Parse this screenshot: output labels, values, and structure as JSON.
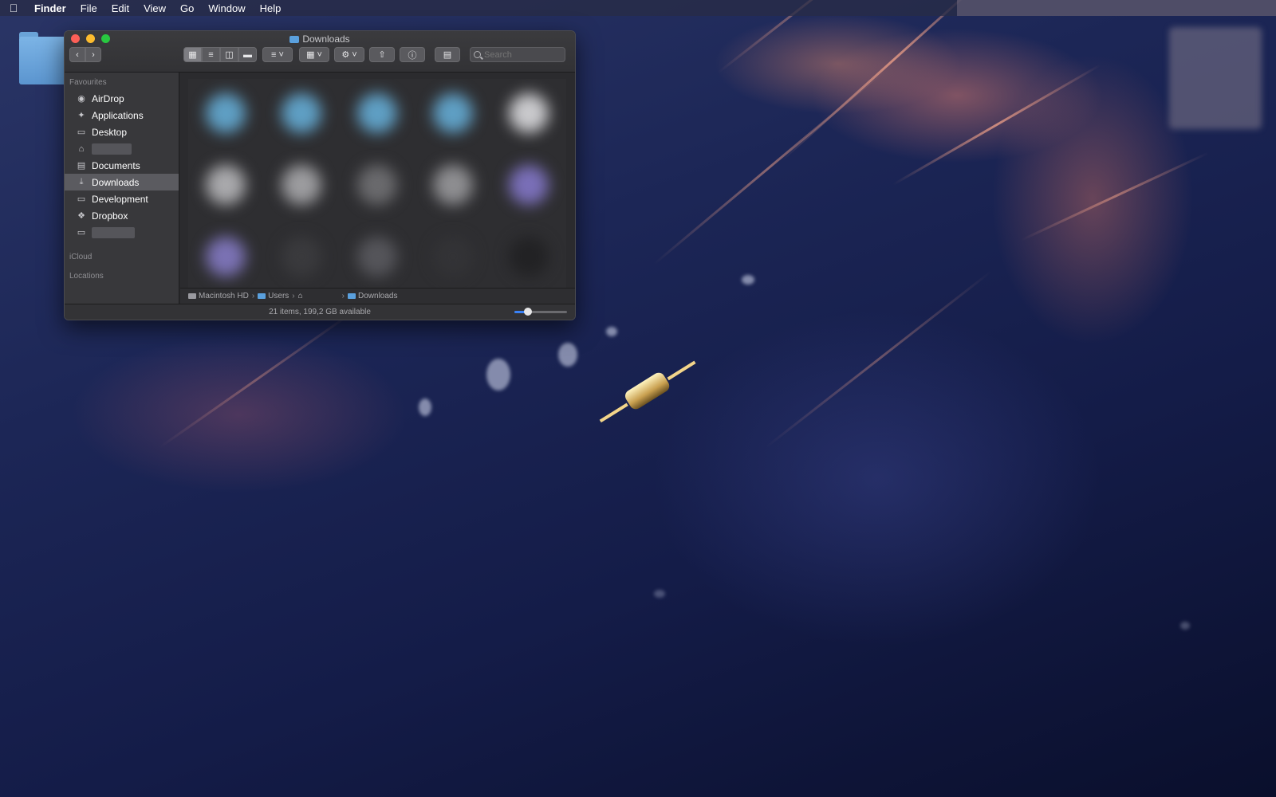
{
  "menubar": {
    "apple_icon": "apple-logo-icon",
    "app_name": "Finder",
    "menus": [
      "File",
      "Edit",
      "View",
      "Go",
      "Window",
      "Help"
    ]
  },
  "window": {
    "title": "Downloads",
    "search": {
      "placeholder": "Search"
    },
    "sidebar": {
      "sections": {
        "favourites": "Favourites",
        "icloud": "iCloud",
        "locations": "Locations"
      },
      "items": [
        {
          "label": "AirDrop",
          "icon": "airdrop-icon"
        },
        {
          "label": "Applications",
          "icon": "applications-icon"
        },
        {
          "label": "Desktop",
          "icon": "desktop-icon"
        },
        {
          "label": "",
          "icon": "home-icon"
        },
        {
          "label": "Documents",
          "icon": "documents-icon"
        },
        {
          "label": "Downloads",
          "icon": "downloads-icon",
          "selected": true
        },
        {
          "label": "Development",
          "icon": "folder-icon"
        },
        {
          "label": "Dropbox",
          "icon": "dropbox-icon"
        },
        {
          "label": "",
          "icon": "folder-icon"
        }
      ]
    },
    "path": {
      "items": [
        "Macintosh HD",
        "Users",
        "",
        "Downloads"
      ]
    },
    "status": "21 items, 199,2 GB available",
    "icon_size_fraction": 0.25
  }
}
